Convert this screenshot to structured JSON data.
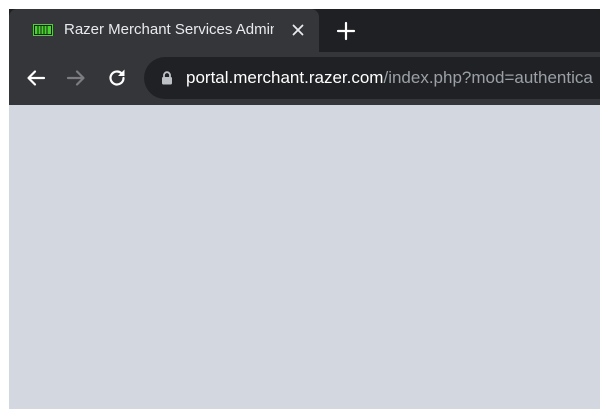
{
  "tab": {
    "title": "Razer Merchant Services Admin",
    "favicon": "razer-favicon-icon",
    "close_icon": "close-icon"
  },
  "new_tab_icon": "plus-icon",
  "toolbar": {
    "back_icon": "back-arrow-icon",
    "forward_icon": "forward-arrow-icon",
    "reload_icon": "reload-icon"
  },
  "omnibox": {
    "lock_icon": "lock-icon",
    "url_host": "portal.merchant.razer.com",
    "url_path": "/index.php?mod=authentica"
  },
  "colors": {
    "tab_background": "#35363a",
    "tabstrip_background": "#1f2023",
    "omnibox_background": "#202124",
    "content_background": "#d3d7df",
    "favicon_green": "#44d62c"
  }
}
